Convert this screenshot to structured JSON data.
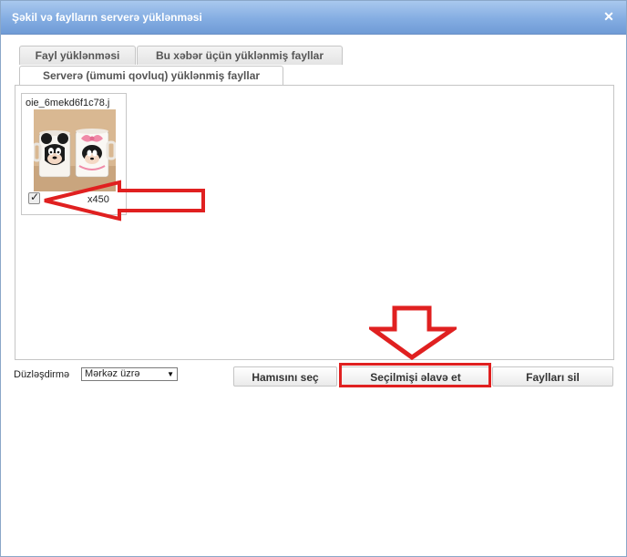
{
  "dialog": {
    "title": "Şəkil və faylların serverə yüklənməsi",
    "close_icon": "close-icon"
  },
  "tabs": [
    {
      "label": "Fayl yüklənməsi",
      "active": false
    },
    {
      "label": "Bu xəbər üçün yüklənmiş fayllar",
      "active": false
    },
    {
      "label": "Serverə (ümumi qovluq) yüklənmiş fayllar",
      "active": true
    }
  ],
  "files": [
    {
      "name": "oie_6mekd6f1c78.j",
      "size": "x450",
      "checked": true,
      "image": "mugs-thumbnail"
    }
  ],
  "alignment": {
    "label": "Düzləşdirmə",
    "selected": "Mərkəz üzrə"
  },
  "buttons": {
    "select_all": "Hamısını seç",
    "add_selected": "Seçilmişi əlavə et",
    "delete_files": "Faylları sil"
  },
  "annotation_color": "#e02020"
}
